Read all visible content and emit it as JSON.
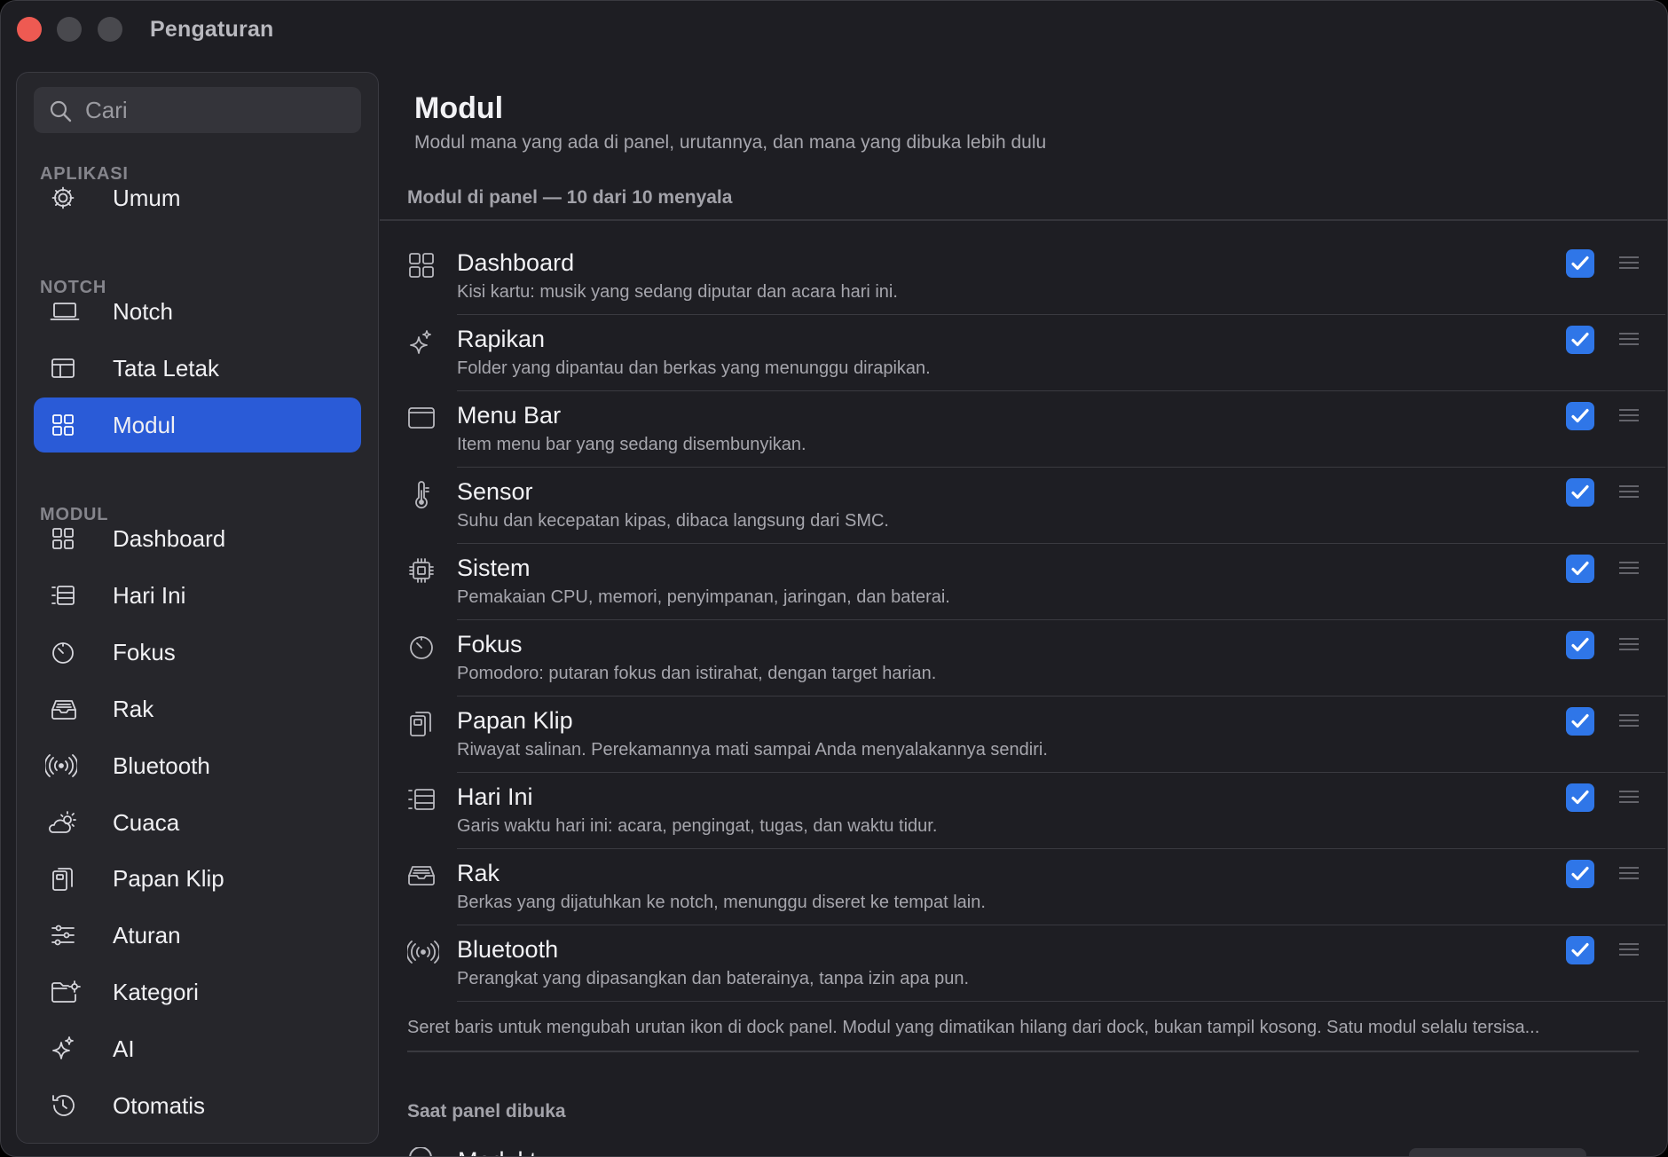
{
  "window": {
    "title": "Pengaturan"
  },
  "sidebar": {
    "search_placeholder": "Cari",
    "sections": {
      "aplikasi": "APLIKASI",
      "notch": "NOTCH",
      "modul": "MODUL"
    },
    "items": [
      {
        "label": "Umum",
        "icon": "gear-icon"
      },
      {
        "label": "Notch",
        "icon": "laptop-icon"
      },
      {
        "label": "Tata Letak",
        "icon": "layout-icon"
      },
      {
        "label": "Modul",
        "icon": "grid-icon",
        "active": true
      },
      {
        "label": "Dashboard",
        "icon": "grid-icon"
      },
      {
        "label": "Hari Ini",
        "icon": "timeline-icon"
      },
      {
        "label": "Fokus",
        "icon": "timer-icon"
      },
      {
        "label": "Rak",
        "icon": "tray-icon"
      },
      {
        "label": "Bluetooth",
        "icon": "broadcast-icon"
      },
      {
        "label": "Cuaca",
        "icon": "cloud-sun-icon"
      },
      {
        "label": "Papan Klip",
        "icon": "clipboard-icon"
      },
      {
        "label": "Aturan",
        "icon": "sliders-icon"
      },
      {
        "label": "Kategori",
        "icon": "folder-gear-icon"
      },
      {
        "label": "AI",
        "icon": "sparkles-icon"
      },
      {
        "label": "Otomatis",
        "icon": "history-icon"
      }
    ]
  },
  "main": {
    "title": "Modul",
    "subtitle": "Modul mana yang ada di panel, urutannya, dan mana yang dibuka lebih dulu",
    "group1_header": "Modul di panel — 10 dari 10 menyala",
    "modules": [
      {
        "title": "Dashboard",
        "desc": "Kisi kartu: musik yang sedang diputar dan acara hari ini.",
        "icon": "grid-icon",
        "enabled": true
      },
      {
        "title": "Rapikan",
        "desc": "Folder yang dipantau dan berkas yang menunggu dirapikan.",
        "icon": "sparkles-icon",
        "enabled": true
      },
      {
        "title": "Menu Bar",
        "desc": "Item menu bar yang sedang disembunyikan.",
        "icon": "window-icon",
        "enabled": true
      },
      {
        "title": "Sensor",
        "desc": "Suhu dan kecepatan kipas, dibaca langsung dari SMC.",
        "icon": "thermometer-icon",
        "enabled": true
      },
      {
        "title": "Sistem",
        "desc": "Pemakaian CPU, memori, penyimpanan, jaringan, dan baterai.",
        "icon": "cpu-icon",
        "enabled": true
      },
      {
        "title": "Fokus",
        "desc": "Pomodoro: putaran fokus dan istirahat, dengan target harian.",
        "icon": "timer-icon",
        "enabled": true
      },
      {
        "title": "Papan Klip",
        "desc": "Riwayat salinan. Perekamannya mati sampai Anda menyalakannya sendiri.",
        "icon": "clipboard-icon",
        "enabled": true
      },
      {
        "title": "Hari Ini",
        "desc": "Garis waktu hari ini: acara, pengingat, tugas, dan waktu tidur.",
        "icon": "timeline-icon",
        "enabled": true
      },
      {
        "title": "Rak",
        "desc": "Berkas yang dijatuhkan ke notch, menunggu diseret ke tempat lain.",
        "icon": "tray-icon",
        "enabled": true
      },
      {
        "title": "Bluetooth",
        "desc": "Perangkat yang dipasangkan dan baterainya, tanpa izin apa pun.",
        "icon": "broadcast-icon",
        "enabled": true
      }
    ],
    "footnote": "Seret baris untuk mengubah urutan ikon di dock panel. Modul yang dimatikan hilang dari dock, bukan tampil kosong. Satu modul selalu tersisa...",
    "group2_header": "Saat panel dibuka",
    "group2_first_item": "Modul t"
  },
  "colors": {
    "accent": "#2a5bd7",
    "checkbox": "#2f76e8",
    "window_bg": "#1e1e23",
    "sidebar_bg": "#26262b",
    "close": "#ee5a52"
  }
}
